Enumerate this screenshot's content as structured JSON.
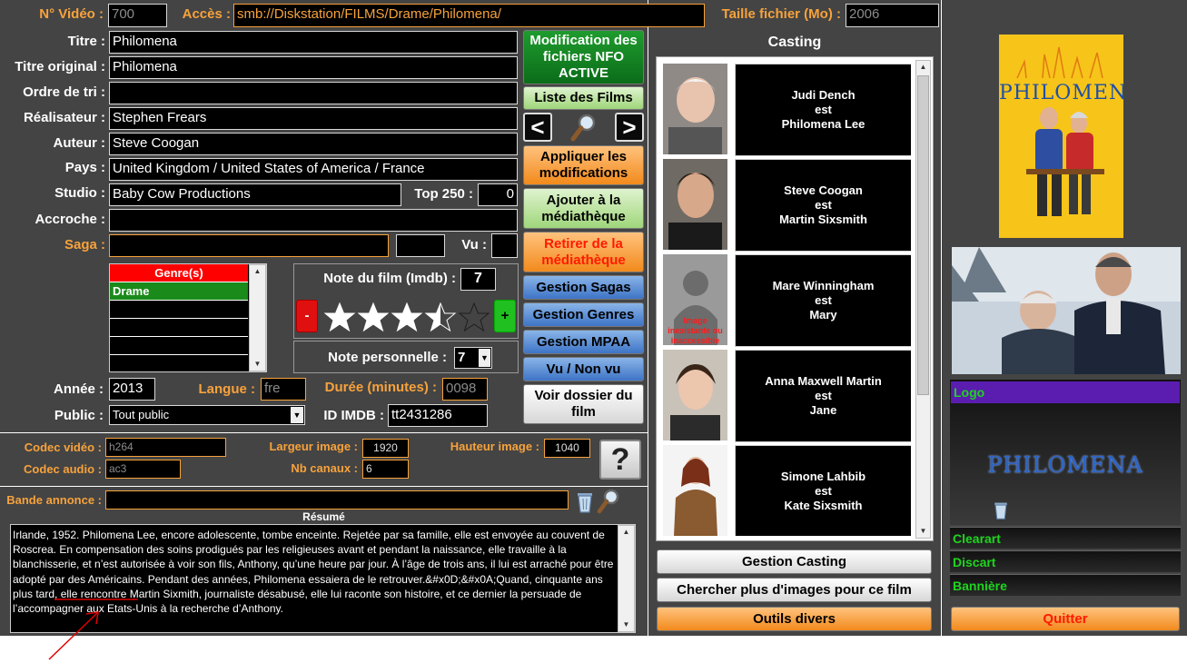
{
  "header": {
    "no_video_label": "N° Vidéo :",
    "no_video_value": "700",
    "acces_label": "Accès :",
    "acces_value": "smb://Diskstation/FILMS/Drame/Philomena/",
    "taille_label": "Taille fichier (Mo) :",
    "taille_value": "2006"
  },
  "fields": {
    "titre_label": "Titre :",
    "titre_value": "Philomena",
    "titre_original_label": "Titre original :",
    "titre_original_value": "Philomena",
    "ordre_label": "Ordre de tri :",
    "ordre_value": "",
    "realisateur_label": "Réalisateur :",
    "realisateur_value": "Stephen Frears",
    "auteur_label": "Auteur :",
    "auteur_value": "Steve Coogan",
    "pays_label": "Pays :",
    "pays_value": "United Kingdom / United States of America / France",
    "studio_label": "Studio :",
    "studio_value": "Baby Cow Productions",
    "top250_label": "Top 250 :",
    "top250_value": "0",
    "accroche_label": "Accroche :",
    "accroche_value": "",
    "saga_label": "Saga :",
    "saga_value": "",
    "saga_num": "",
    "vu_label": "Vu :",
    "vu_value": ""
  },
  "genres": {
    "header": "Genre(s)",
    "items": [
      "Drame",
      "",
      "",
      "",
      ""
    ]
  },
  "ratings": {
    "imdb_label": "Note du film (Imdb) :",
    "imdb_value": "7",
    "stars_filled": 3.5,
    "stars_total": 5,
    "minus": "-",
    "plus": "+",
    "perso_label": "Note personnelle :",
    "perso_value": "7"
  },
  "details": {
    "annee_label": "Année :",
    "annee_value": "2013",
    "langue_label": "Langue :",
    "langue_value": "fre",
    "duree_label": "Durée (minutes) :",
    "duree_value": "0098",
    "public_label": "Public :",
    "public_value": "Tout public",
    "imdb_id_label": "ID IMDB :",
    "imdb_id_value": "tt2431286"
  },
  "buttons": {
    "nfo": "Modification des fichiers NFO ACTIVE",
    "liste": "Liste des Films",
    "prev": "<",
    "next": ">",
    "appliquer": "Appliquer les modifications",
    "ajouter": "Ajouter à la médiathèque",
    "retirer": "Retirer de la médiathèque",
    "sagas": "Gestion Sagas",
    "genres": "Gestion Genres",
    "mpaa": "Gestion MPAA",
    "vu": "Vu / Non vu",
    "dossier": "Voir dossier du film",
    "help": "?",
    "gestion_casting": "Gestion Casting",
    "chercher": "Chercher plus d'images pour ce film",
    "outils": "Outils divers",
    "quitter": "Quitter"
  },
  "tech": {
    "codec_video_label": "Codec vidéo :",
    "codec_video_value": "h264",
    "codec_audio_label": "Codec audio :",
    "codec_audio_value": "ac3",
    "largeur_label": "Largeur image :",
    "largeur_value": "1920",
    "nbcanaux_label": "Nb canaux :",
    "nbcanaux_value": "6",
    "hauteur_label": "Hauteur image :",
    "hauteur_value": "1040"
  },
  "bande": {
    "label": "Bande annonce :",
    "value": ""
  },
  "resume": {
    "title": "Résumé",
    "text": "Irlande, 1952. Philomena Lee, encore adolescente, tombe enceinte. Rejetée par sa famille, elle est envoyée au couvent de Roscrea. En compensation des soins prodigués par les religieuses avant et pendant la naissance, elle travaille à la blanchisserie, et n’est autorisée à voir son fils, Anthony, qu’une heure par jour. À l’âge de trois ans, il lui est arraché pour être adopté par des Américains. Pendant des années, Philomena essaiera de le retrouver.&#x0D;&#x0A;Quand, cinquante ans plus tard, elle rencontre Martin Sixmith, journaliste désabusé, elle lui raconte son histoire, et ce dernier la persuade de l’accompagner aux Etats-Unis à la recherche d’Anthony."
  },
  "casting": {
    "title": "Casting",
    "role_word": "est",
    "missing_image": "Image inexistante ou inaccessible",
    "actors": [
      {
        "name": "Judi Dench",
        "role": "Philomena Lee"
      },
      {
        "name": "Steve Coogan",
        "role": "Martin Sixsmith"
      },
      {
        "name": "Mare Winningham",
        "role": "Mary"
      },
      {
        "name": "Anna Maxwell Martin",
        "role": "Jane"
      },
      {
        "name": "Simone Lahbib",
        "role": "Kate Sixsmith"
      }
    ]
  },
  "artwork": {
    "poster_title": "PHILOMENA",
    "logo_label": "Logo",
    "logo_text": "PHILOMENA",
    "clearart_label": "Clearart",
    "discart_label": "Discart",
    "banniere_label": "Bannière"
  },
  "colors": {
    "panel": "#444444",
    "accent_orange": "#f7a23c",
    "genre_header": "#ff0000",
    "genre_selected": "#1a8a1a",
    "logo_bar": "#5b1db0",
    "art_label_green": "#1ed51e"
  }
}
